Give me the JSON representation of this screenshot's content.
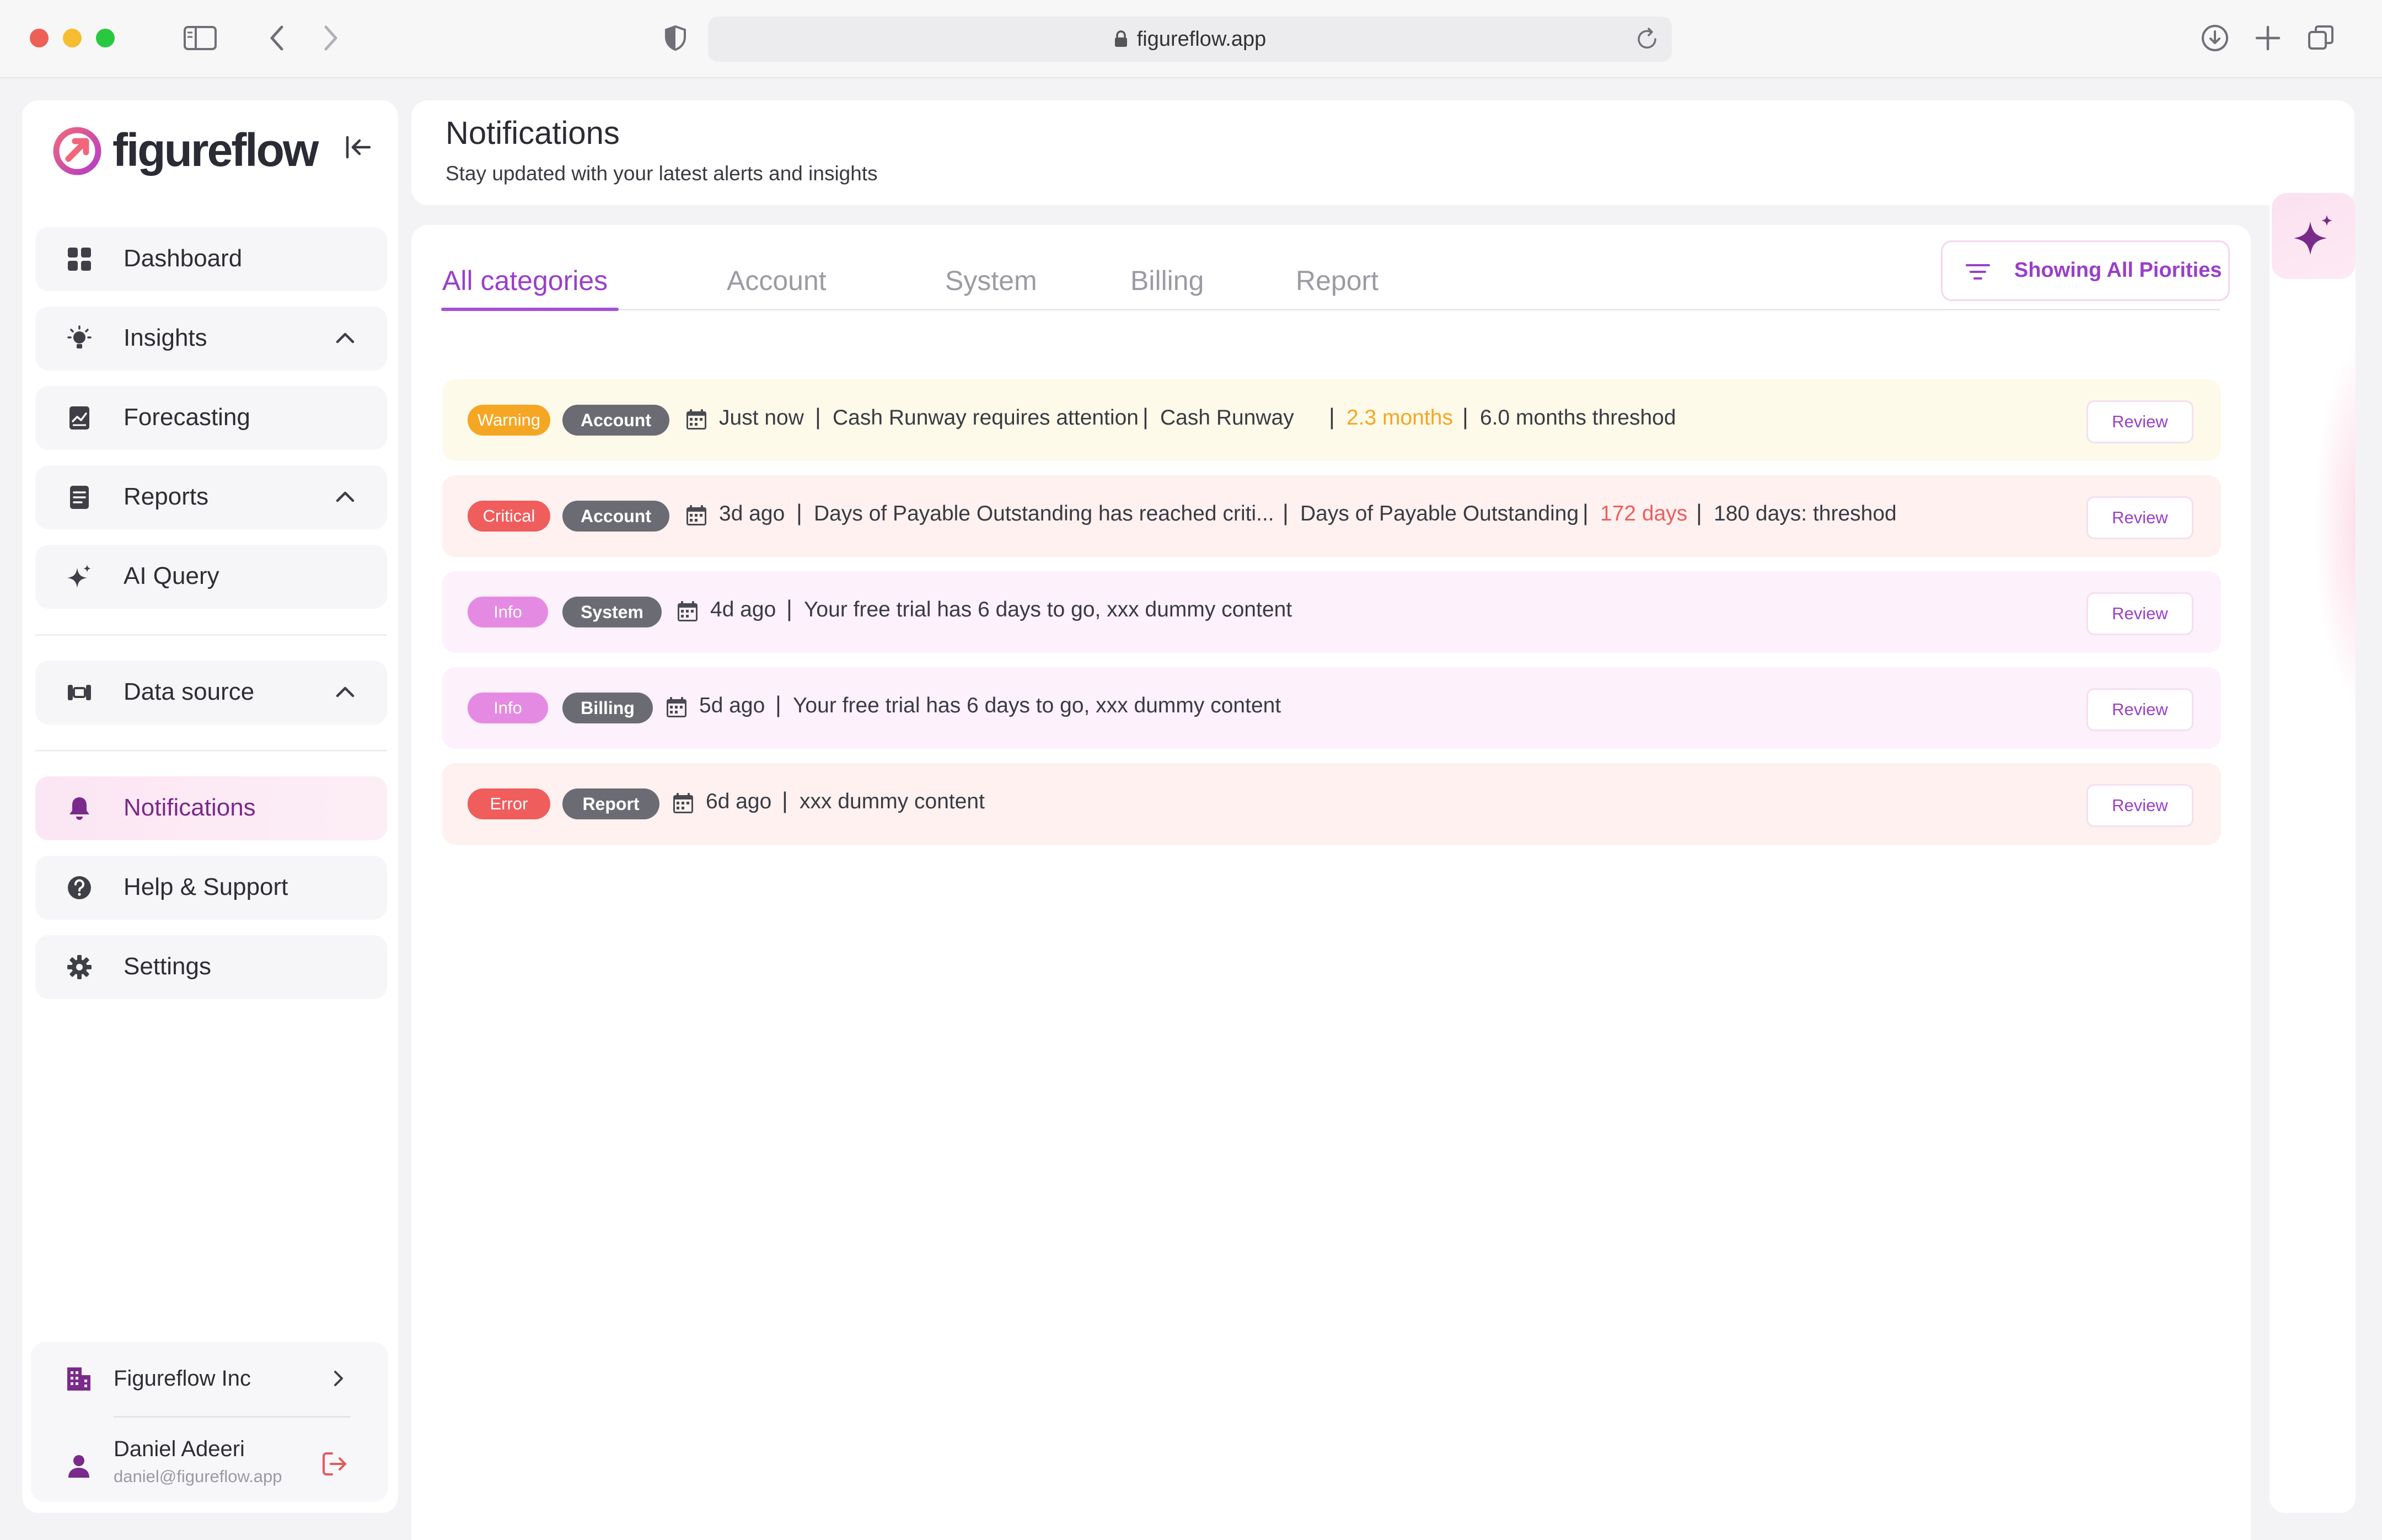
{
  "browser": {
    "url": "figureflow.app",
    "traffic_colors": [
      "#ee5f57",
      "#f5bd2f",
      "#28c840"
    ]
  },
  "sidebar": {
    "brand": "figureflow",
    "nav": [
      {
        "label": "Dashboard",
        "icon": "grid-icon"
      },
      {
        "label": "Insights",
        "icon": "lightbulb-icon",
        "expandable": true
      },
      {
        "label": "Forecasting",
        "icon": "chart-doc-icon"
      },
      {
        "label": "Reports",
        "icon": "document-icon",
        "expandable": true
      },
      {
        "label": "AI Query",
        "icon": "sparkle-icon"
      },
      {
        "label": "Data source",
        "icon": "database-icon",
        "expandable": true
      },
      {
        "label": "Notifications",
        "icon": "bell-icon",
        "active": true
      },
      {
        "label": "Help & Support",
        "icon": "help-icon"
      },
      {
        "label": "Settings",
        "icon": "gear-icon"
      }
    ],
    "org": {
      "name": "Figureflow Inc"
    },
    "user": {
      "name": "Daniel Adeeri",
      "email": "daniel@figureflow.app"
    }
  },
  "header": {
    "title": "Notifications",
    "subtitle": "Stay updated with your latest alerts and insights"
  },
  "tabs": [
    "All categories",
    "Account",
    "System",
    "Billing",
    "Report"
  ],
  "filter": {
    "label": "Showing All Piorities"
  },
  "colors": {
    "accent": "#9a3fc9",
    "warning": "#f5a623",
    "critical": "#ef5d5d",
    "info": "#e58ae3",
    "error": "#ef5d5d"
  },
  "notifications": [
    {
      "level": "Warning",
      "category": "Account",
      "time": "Just now",
      "message": "Cash Runway requires attention",
      "metric": "Cash Runway",
      "value": "2.3 months",
      "threshold": "6.0 months threshod",
      "action": "Review"
    },
    {
      "level": "Critical",
      "category": "Account",
      "time": "3d ago",
      "message": "Days of Payable Outstanding has reached criti...",
      "metric": "Days of Payable Outstanding",
      "value": "172 days",
      "threshold": "180 days:  threshod",
      "action": "Review"
    },
    {
      "level": "Info",
      "category": "System",
      "time": "4d ago",
      "message": "Your free trial has 6 days to go, xxx dummy content",
      "action": "Review"
    },
    {
      "level": "Info",
      "category": "Billing",
      "time": "5d ago",
      "message": "Your free trial has 6 days to go, xxx dummy content",
      "action": "Review"
    },
    {
      "level": "Error",
      "category": "Report",
      "time": "6d ago",
      "message": "xxx dummy content",
      "action": "Review"
    }
  ]
}
